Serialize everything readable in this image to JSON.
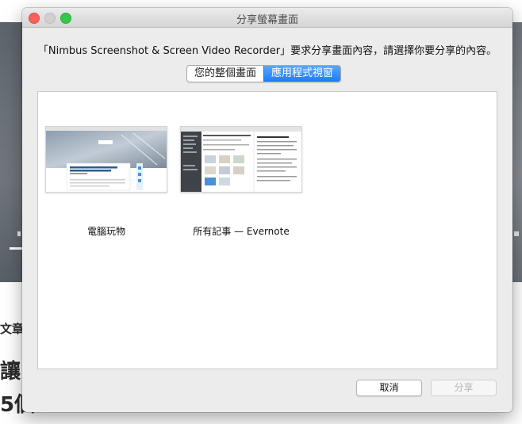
{
  "background": {
    "chars": [
      "文章",
      "讓",
      "5個"
    ]
  },
  "dialog": {
    "title": "分享螢幕畫面",
    "prompt": "「Nimbus Screenshot & Screen Video Recorder」要求分享畫面內容，請選擇你要分享的內容。",
    "tabs": [
      {
        "label": "您的整個畫面",
        "selected": false
      },
      {
        "label": "應用程式視窗",
        "selected": true
      }
    ],
    "windows": [
      {
        "label": "電腦玩物"
      },
      {
        "label": "所有記事 — Evernote"
      }
    ],
    "buttons": {
      "cancel": "取消",
      "share": "分享"
    }
  },
  "colors": {
    "accent": "#1d7cf5",
    "close": "#fc605c",
    "maximize": "#34c84a"
  }
}
